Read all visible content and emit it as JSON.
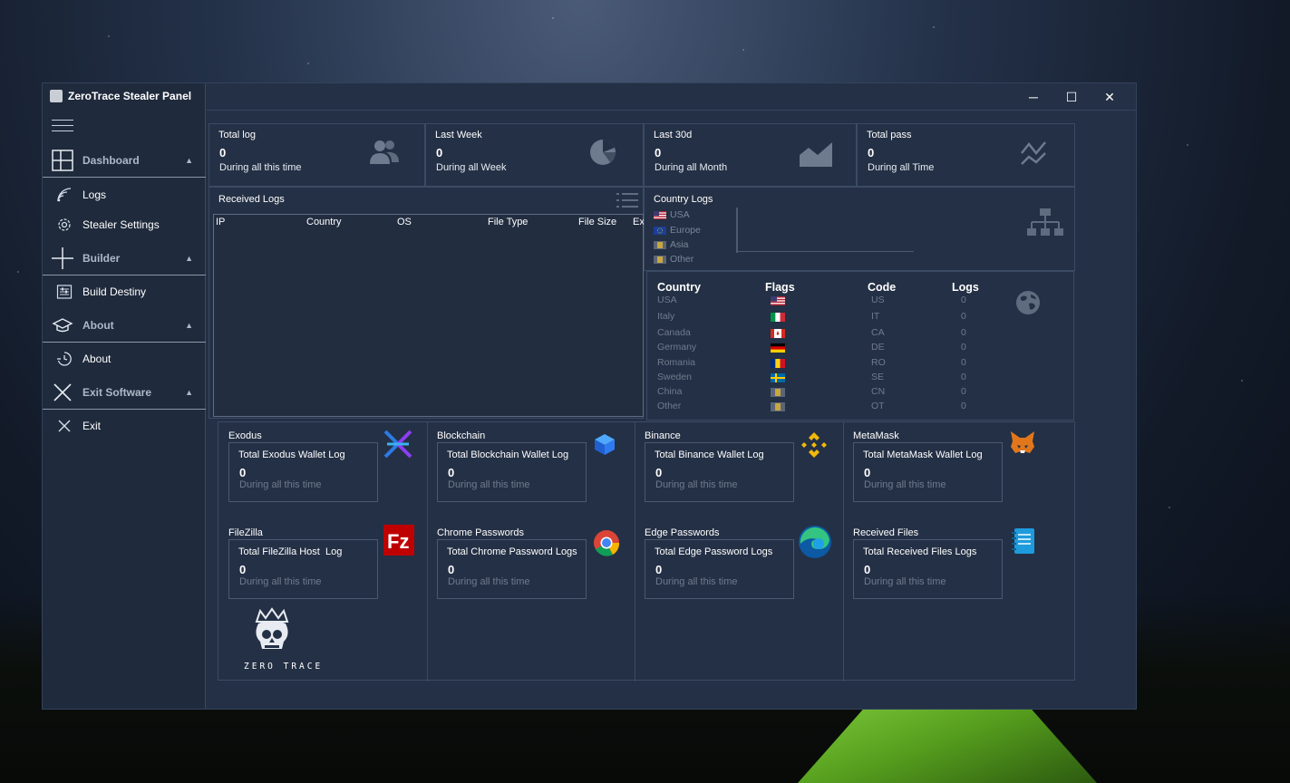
{
  "app": {
    "title": "ZeroTrace Stealer Panel"
  },
  "window_controls": {
    "minimize": "─",
    "maximize": "☐",
    "close": "✕"
  },
  "sidebar": {
    "sections": [
      {
        "label": "Dashboard",
        "icon": "dashboard-icon",
        "items": [
          {
            "label": "Logs",
            "icon": "signal-icon"
          },
          {
            "label": "Stealer Settings",
            "icon": "gear-icon"
          }
        ]
      },
      {
        "label": "Builder",
        "icon": "plus-icon",
        "items": [
          {
            "label": "Build Destiny",
            "icon": "build-icon"
          }
        ]
      },
      {
        "label": "About",
        "icon": "graduation-cap-icon",
        "items": [
          {
            "label": "About",
            "icon": "about-icon"
          }
        ]
      },
      {
        "label": "Exit Software",
        "icon": "close-icon",
        "items": [
          {
            "label": "Exit",
            "icon": "close-icon"
          }
        ]
      }
    ]
  },
  "stats": [
    {
      "title": "Total log",
      "value": "0",
      "subtitle": "During all this time",
      "icon": "users-icon"
    },
    {
      "title": "Last Week",
      "value": "0",
      "subtitle": "During all Week",
      "icon": "pie-chart-icon"
    },
    {
      "title": "Last 30d",
      "value": "0",
      "subtitle": "During all Month",
      "icon": "area-chart-icon"
    },
    {
      "title": "Total pass",
      "value": "0",
      "subtitle": "During all Time",
      "icon": "trend-icon"
    }
  ],
  "received_logs": {
    "title": "Received Logs",
    "columns": [
      "IP",
      "Country",
      "OS",
      "File Type",
      "File Size",
      "Ex"
    ]
  },
  "country_logs": {
    "title": "Country Logs",
    "legend": [
      "USA",
      "Europe",
      "Asia",
      "Other"
    ]
  },
  "country_table": {
    "headers": [
      "Country",
      "Flags",
      "Code",
      "Logs"
    ],
    "rows": [
      {
        "country": "USA",
        "code": "US",
        "logs": "0"
      },
      {
        "country": "Italy",
        "code": "IT",
        "logs": "0"
      },
      {
        "country": "Canada",
        "code": "CA",
        "logs": "0"
      },
      {
        "country": "Germany",
        "code": "DE",
        "logs": "0"
      },
      {
        "country": "Romania",
        "code": "RO",
        "logs": "0"
      },
      {
        "country": "Sweden",
        "code": "SE",
        "logs": "0"
      },
      {
        "country": "China",
        "code": "CN",
        "logs": "0"
      },
      {
        "country": "Other",
        "code": "OT",
        "logs": "0"
      }
    ]
  },
  "wallets": [
    {
      "title": "Exodus",
      "label": "Total Exodus Wallet Log",
      "value": "0",
      "sub": "During all this time",
      "icon": "exodus-icon"
    },
    {
      "title": "Blockchain",
      "label": "Total Blockchain Wallet Log",
      "value": "0",
      "sub": "During all this time",
      "icon": "blockchain-icon"
    },
    {
      "title": "Binance",
      "label": "Total Binance Wallet Log",
      "value": "0",
      "sub": "During all this time",
      "icon": "binance-icon"
    },
    {
      "title": "MetaMask",
      "label": "Total MetaMask Wallet Log",
      "value": "0",
      "sub": "During all this time",
      "icon": "metamask-icon"
    },
    {
      "title": "FileZilla",
      "label": "Total FileZilla Host  Log",
      "value": "0",
      "sub": "During all this time",
      "icon": "filezilla-icon"
    },
    {
      "title": "Chrome Passwords",
      "label": "Total Chrome Password Logs",
      "value": "0",
      "sub": "During all this time",
      "icon": "chrome-icon"
    },
    {
      "title": "Edge Passwords",
      "label": "Total Edge Password Logs",
      "value": "0",
      "sub": "During all this time",
      "icon": "edge-icon"
    },
    {
      "title": "Received Files",
      "label": "Total Received Files Logs",
      "value": "0",
      "sub": "During all this time",
      "icon": "notebook-icon"
    }
  ],
  "logo": {
    "text": "ZERO TRACE"
  },
  "colors": {
    "window_bg": "#243045",
    "sidebar_bg": "#1f2a3c",
    "border": "#3b4b64",
    "muted_text": "#6f7b8d"
  }
}
